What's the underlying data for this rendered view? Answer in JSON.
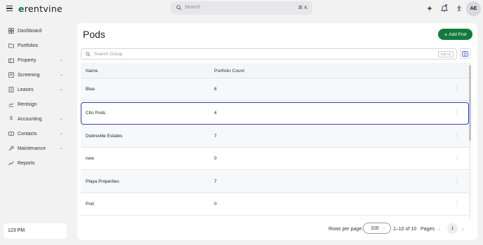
{
  "header": {
    "brand": "rentvine",
    "brand_mark": "e",
    "search_placeholder": "Search",
    "search_shortcut": "⌘ K",
    "avatar_initials": "AE"
  },
  "sidebar": {
    "items": [
      {
        "label": "Dashboard",
        "icon": "grid-icon",
        "has_chevron": false
      },
      {
        "label": "Portfolios",
        "icon": "folder-icon",
        "has_chevron": false
      },
      {
        "label": "Property",
        "icon": "building-icon",
        "has_chevron": true
      },
      {
        "label": "Screening",
        "icon": "screening-icon",
        "has_chevron": true
      },
      {
        "label": "Leases",
        "icon": "lease-icon",
        "has_chevron": true
      },
      {
        "label": "Rentsign",
        "icon": "signature-icon",
        "has_chevron": false
      },
      {
        "label": "Accounting",
        "icon": "dollar-icon",
        "has_chevron": true
      },
      {
        "label": "Contacts",
        "icon": "contacts-icon",
        "has_chevron": true
      },
      {
        "label": "Maintenance",
        "icon": "wrench-icon",
        "has_chevron": true
      },
      {
        "label": "Reports",
        "icon": "reports-icon",
        "has_chevron": false
      }
    ],
    "time": "123 PM"
  },
  "main": {
    "title": "Pods",
    "add_button": "Add Pod",
    "group_search_placeholder": "Search Group",
    "group_search_shortcut": "Ctrl +K",
    "columns": [
      "Name",
      "Portfolio Count"
    ],
    "rows": [
      {
        "name": "Blue",
        "count": "8"
      },
      {
        "name": "Cito Pods",
        "count": "4"
      },
      {
        "name": "Dubreville Estates",
        "count": "7"
      },
      {
        "name": "new",
        "count": "0"
      },
      {
        "name": "Playa Properties",
        "count": "7"
      },
      {
        "name": "Pod",
        "count": "0"
      }
    ],
    "selected_row": 1,
    "pagination": {
      "rows_per_page_label": "Rows per page:",
      "rows_per_page_value": "100",
      "range": "1–10 of 10",
      "pages_label": "Pages",
      "current_page": "1"
    }
  },
  "colors": {
    "brand_green": "#137a3e",
    "selected_border": "#2d3dbd",
    "background": "#f2f2f3"
  }
}
